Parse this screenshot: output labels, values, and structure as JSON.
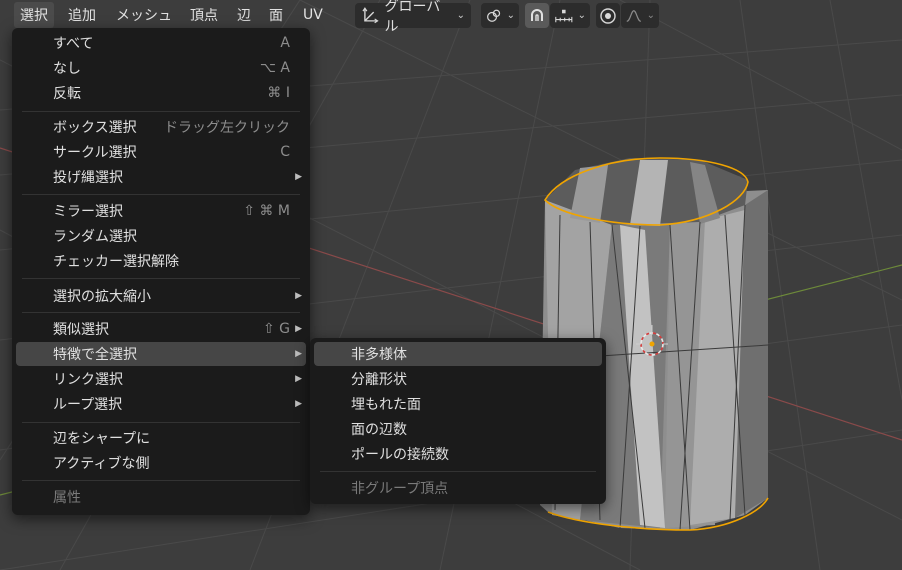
{
  "header": {
    "menus": [
      {
        "label": "選択",
        "active": true
      },
      {
        "label": "追加"
      },
      {
        "label": "メッシュ"
      },
      {
        "label": "頂点"
      },
      {
        "label": "辺"
      },
      {
        "label": "面"
      },
      {
        "label": "UV"
      }
    ],
    "transform_orientation": "グローバル",
    "icons": [
      "transform-icon",
      "link-icon",
      "snap-icon",
      "snap-increment-icon",
      "proportional-edit-icon",
      "falloff-icon"
    ]
  },
  "select_menu": {
    "items": {
      "all": {
        "label": "すべて",
        "shortcut": "A"
      },
      "none": {
        "label": "なし",
        "shortcut": "⌥ A"
      },
      "invert": {
        "label": "反転",
        "shortcut": "⌘ I"
      },
      "box": {
        "label": "ボックス選択",
        "shortcut": "ドラッグ左クリック"
      },
      "circle": {
        "label": "サークル選択",
        "shortcut": "C"
      },
      "lasso": {
        "label": "投げ縄選択"
      },
      "mirror": {
        "label": "ミラー選択",
        "shortcut": "⇧ ⌘ M"
      },
      "random": {
        "label": "ランダム選択"
      },
      "checker": {
        "label": "チェッカー選択解除"
      },
      "more_less": {
        "label": "選択の拡大縮小"
      },
      "similar": {
        "label": "類似選択",
        "shortcut": "⇧ G"
      },
      "all_by_trait": {
        "label": "特徴で全選択"
      },
      "linked": {
        "label": "リンク選択"
      },
      "loops": {
        "label": "ループ選択"
      },
      "sharp_edges": {
        "label": "辺をシャープに"
      },
      "side_of_active": {
        "label": "アクティブな側"
      },
      "attribute": {
        "label": "属性"
      }
    }
  },
  "sub_menu": {
    "items": {
      "non_manifold": {
        "label": "非多様体"
      },
      "loose": {
        "label": "分離形状"
      },
      "interior_faces": {
        "label": "埋もれた面"
      },
      "face_sides": {
        "label": "面の辺数"
      },
      "poles": {
        "label": "ポールの接続数"
      },
      "ungrouped": {
        "label": "非グループ頂点"
      }
    }
  },
  "colors": {
    "viewport_bg": "#3d3d3d",
    "grid": "#494949",
    "x_axis": "#8a4a4a",
    "y_axis": "#6d8a3a",
    "selection_outline": "#f0a400",
    "menu_bg": "#1b1b1b",
    "menu_highlight": "#464646"
  }
}
